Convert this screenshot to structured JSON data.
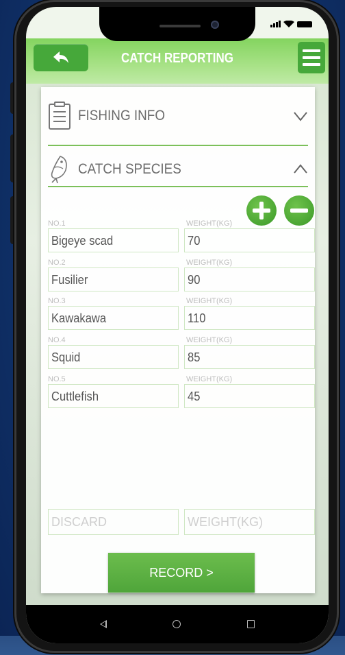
{
  "header": {
    "title": "CATCH REPORTING"
  },
  "sections": {
    "fishing_info": "FISHING INFO",
    "catch_species": "CATCH SPECIES"
  },
  "catch_rows": [
    {
      "no_label": "NO.1",
      "weight_label": "WEIGHT(KG)",
      "species": "Bigeye scad",
      "weight": "70"
    },
    {
      "no_label": "NO.2",
      "weight_label": "WEIGHT(KG)",
      "species": "Fusilier",
      "weight": "90"
    },
    {
      "no_label": "NO.3",
      "weight_label": "WEIGHT(KG)",
      "species": "Kawakawa",
      "weight": "110"
    },
    {
      "no_label": "NO.4",
      "weight_label": "WEIGHT(KG)",
      "species": "Squid",
      "weight": "85"
    },
    {
      "no_label": "NO.5",
      "weight_label": "WEIGHT(KG)",
      "species": "Cuttlefish",
      "weight": "45"
    }
  ],
  "discard": {
    "placeholder": "DISCARD",
    "weight_placeholder": "WEIGHT(KG)"
  },
  "record_button": "RECORD >",
  "colors": {
    "accent_green": "#46a83a",
    "header_green": "#84d45f",
    "field_border": "#cfe7c3"
  },
  "icons": {
    "back": "back-arrow-icon",
    "menu": "hamburger-menu-icon",
    "fishing_info": "clipboard-icon",
    "catch_species": "fish-icon",
    "expand": "chevron-down-icon",
    "collapse": "chevron-up-icon",
    "add": "plus-circle-icon",
    "remove": "minus-circle-icon"
  }
}
